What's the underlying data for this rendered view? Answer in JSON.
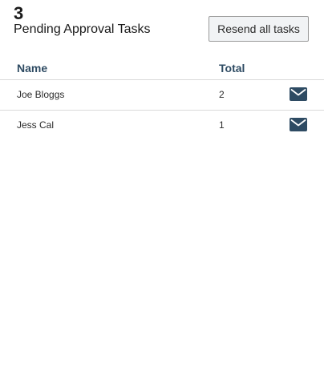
{
  "header": {
    "count": "3",
    "title": "Pending Approval Tasks",
    "resend_label": "Resend all tasks"
  },
  "table": {
    "columns": [
      "Name",
      "Total"
    ],
    "rows": [
      {
        "name": "Joe Bloggs",
        "total": "2",
        "action_icon": "mail-icon"
      },
      {
        "name": "Jess Cal",
        "total": "1",
        "action_icon": "mail-icon"
      }
    ]
  },
  "colors": {
    "accent": "#2e4b63",
    "button_bg": "#f1f3f5",
    "divider": "#d9d9d9"
  }
}
